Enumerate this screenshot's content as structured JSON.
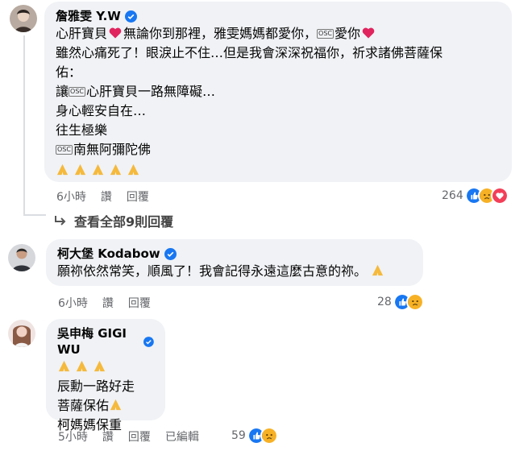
{
  "comments": [
    {
      "name": "詹雅雯 Y.W",
      "lines": {
        "l1a": "心肝寶貝",
        "l1b": "無論你到那裡，雅雯媽媽都愛你，",
        "l1c": "愛你",
        "l2": "雖然心痛死了！眼淚止不住…但是我會深深祝福你，祈求諸佛菩薩保",
        "l3": "佑：",
        "l4a": "讓",
        "l4b": "心肝寶貝一路無障礙…",
        "l5": "身心輕安自在…",
        "l6": "往生極樂",
        "l7": "南無阿彌陀佛"
      },
      "time": "6小時",
      "like": "讚",
      "reply": "回覆",
      "reaction_count": "264"
    },
    {
      "name": "柯大堡 Kodabow",
      "lines": {
        "l1": "願祢依然常笑，順風了！我會記得永遠這麼古意的祢。"
      },
      "time": "6小時",
      "like": "讚",
      "reply": "回覆",
      "reaction_count": "28"
    },
    {
      "name": "吳申梅 GIGI WU",
      "lines": {
        "l2": "辰勳一路好走",
        "l3": "菩薩保佑",
        "l4": "柯媽媽保重"
      },
      "time": "5小時",
      "like": "讚",
      "reply": "回覆",
      "edited": "已編輯",
      "reaction_count": "59"
    }
  ],
  "view_more_replies": "查看全部9則回覆",
  "control_glyph": "OSC",
  "colors": {
    "bubble": "#f0f2f5",
    "like_blue": "#1877f2",
    "love_red": "#f33e58",
    "sad_yellow": "#f7b125"
  }
}
